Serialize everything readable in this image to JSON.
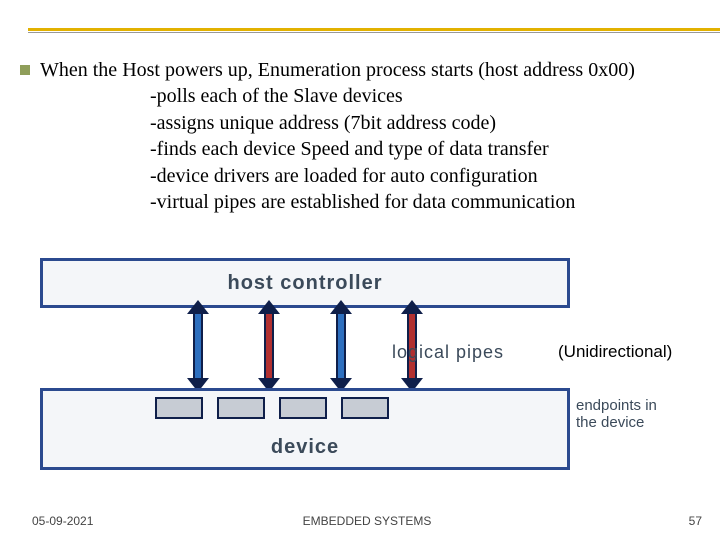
{
  "lead": "When the Host powers up, Enumeration process starts  (host address 0x00)",
  "sub_items": [
    "-polls each of the Slave devices",
    "-assigns unique address (7bit address code)",
    "-finds each device Speed and type of data transfer",
    "-device drivers are loaded for auto configuration",
    "-virtual  pipes are established  for data communication"
  ],
  "diagram": {
    "host": "host controller",
    "logical_pipes": "logical pipes",
    "unidirectional": "(Unidirectional)",
    "device": "device",
    "endpoints_label_l1": "endpoints in",
    "endpoints_label_l2": "the device"
  },
  "footer": {
    "date": "05-09-2021",
    "center": "EMBEDDED SYSTEMS",
    "page": "57"
  }
}
